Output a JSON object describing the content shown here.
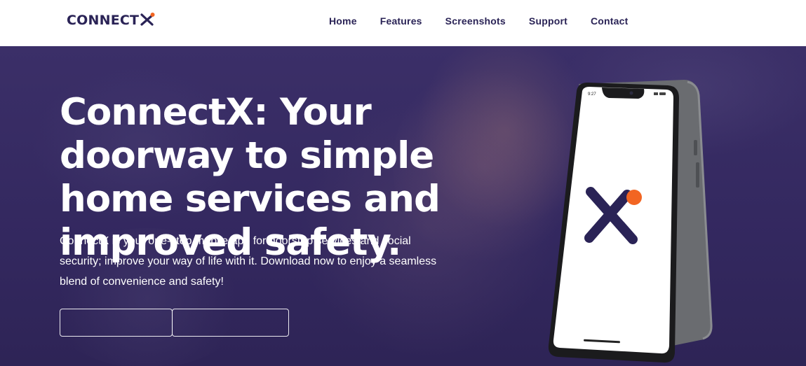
{
  "brand": {
    "name": "CONNECT",
    "accent_color": "#f26522",
    "primary_color": "#2a2356"
  },
  "nav": {
    "items": [
      {
        "label": "Home"
      },
      {
        "label": "Features"
      },
      {
        "label": "Screenshots"
      },
      {
        "label": "Support"
      },
      {
        "label": "Contact"
      }
    ]
  },
  "hero": {
    "headline": "ConnectX: Your doorway to simple home services and improved safety.",
    "subtext": "ConnectX is your one-stop mobile app for doorstep services and social security; improve your way of life with it. Download now to enjoy a seamless blend of convenience and safety!",
    "phone_time": "9:27",
    "app_icon": "connectx-logo-icon",
    "background_color": "#3b2f68"
  }
}
